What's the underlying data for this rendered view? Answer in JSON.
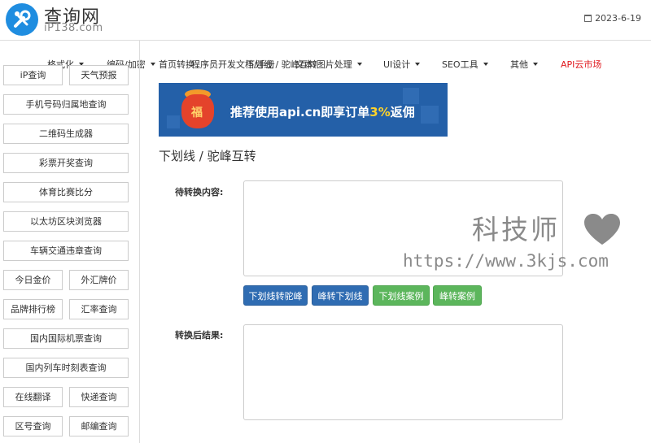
{
  "header": {
    "logo_title": "查询网",
    "logo_subtitle": "iP138.com",
    "date": "2023-6-19"
  },
  "nav": {
    "items": [
      {
        "label": "格式化",
        "caret": true
      },
      {
        "label": "编码/加密",
        "caret": true
      },
      {
        "label": "首页",
        "caret": false
      },
      {
        "label": "转换",
        "caret": false
      },
      {
        "label": "程序员开发文档/手册",
        "caret": false
      },
      {
        "label": "下划线 / 驼峰互转",
        "caret": false
      },
      {
        "label": "文本/图片处理",
        "caret": true
      },
      {
        "label": "UI设计",
        "caret": true
      },
      {
        "label": "SEO工具",
        "caret": true
      },
      {
        "label": "其他",
        "caret": true
      },
      {
        "label": "API云市场",
        "caret": false
      }
    ]
  },
  "sidebar": {
    "buttons": [
      "iP查询",
      "天气预报",
      "手机号码归属地查询",
      "二维码生成器",
      "彩票开奖查询",
      "体育比赛比分",
      "以太坊区块浏览器",
      "车辆交通违章查询",
      "今日金价",
      "外汇牌价",
      "品牌排行榜",
      "汇率查询",
      "国内国际机票查询",
      "国内列车时刻表查询",
      "在线翻译",
      "快递查询",
      "区号查询",
      "邮编查询"
    ]
  },
  "banner": {
    "bag_char": "福",
    "text_before": "推荐使用api.cn即享订单",
    "text_pct": "3%",
    "text_after": "返佣"
  },
  "main": {
    "title": "下划线 / 驼峰互转",
    "input_label": "待转换内容:",
    "input_value": "",
    "output_label": "转换后结果:",
    "output_value": "",
    "buttons": {
      "to_camel": "下划线转驼峰",
      "to_underscore": "峰转下划线",
      "underscore_example": "下划线案例",
      "camel_example": "峰转案例"
    }
  },
  "watermark": {
    "brand": "科技师",
    "url": "https://www.3kjs.com"
  },
  "colors": {
    "primary_blue": "#2f6cb2",
    "green": "#5cb65c",
    "api_red": "#e0191e",
    "logo_blue": "#1f8de0"
  }
}
